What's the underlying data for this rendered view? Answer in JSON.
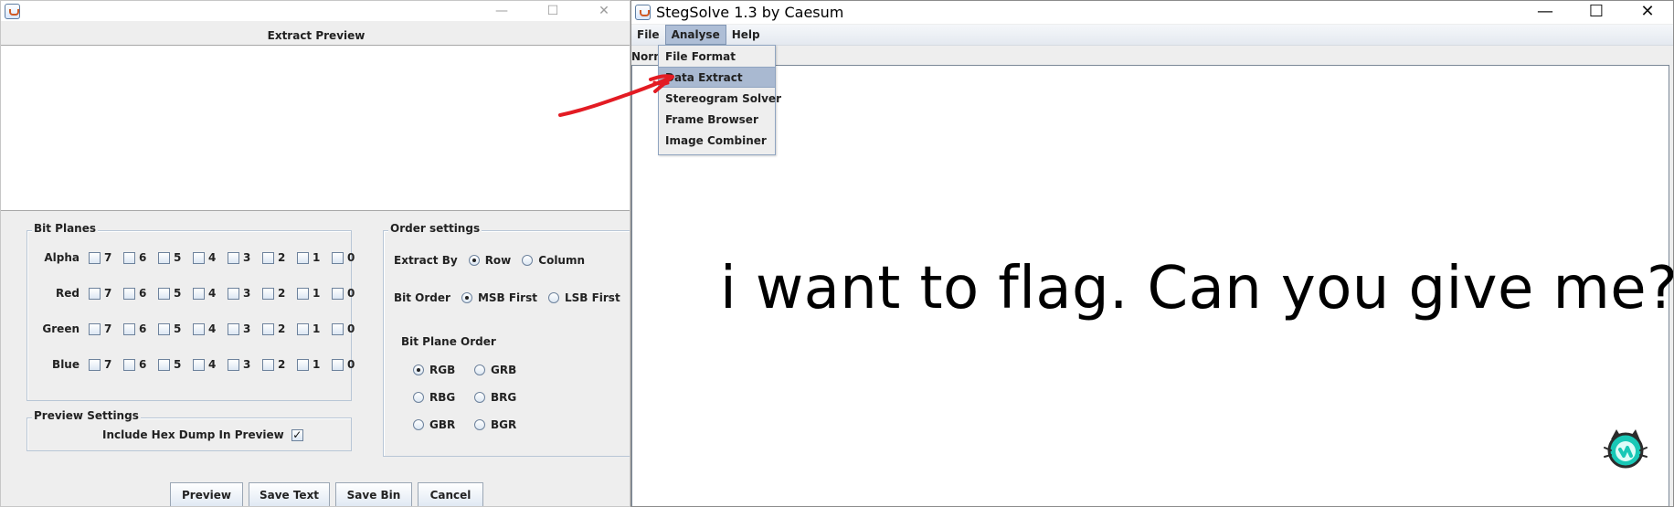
{
  "left_window": {
    "controls": {
      "minimize": "—",
      "maximize": "☐",
      "close": "✕"
    },
    "heading": "Extract Preview",
    "bit_planes": {
      "title": "Bit Planes",
      "rows": [
        {
          "label": "Alpha",
          "bits": [
            "7",
            "6",
            "5",
            "4",
            "3",
            "2",
            "1",
            "0"
          ]
        },
        {
          "label": "Red",
          "bits": [
            "7",
            "6",
            "5",
            "4",
            "3",
            "2",
            "1",
            "0"
          ]
        },
        {
          "label": "Green",
          "bits": [
            "7",
            "6",
            "5",
            "4",
            "3",
            "2",
            "1",
            "0"
          ]
        },
        {
          "label": "Blue",
          "bits": [
            "7",
            "6",
            "5",
            "4",
            "3",
            "2",
            "1",
            "0"
          ]
        }
      ]
    },
    "order_settings": {
      "title": "Order settings",
      "extract_by_label": "Extract By",
      "extract_options": [
        "Row",
        "Column"
      ],
      "selected_extract": "Row",
      "bit_order_label": "Bit Order",
      "bit_order_options": [
        "MSB First",
        "LSB First"
      ],
      "selected_bit_order": "MSB First",
      "bit_plane_order_label": "Bit Plane Order",
      "plane_options": [
        "RGB",
        "GRB",
        "RBG",
        "BRG",
        "GBR",
        "BGR"
      ],
      "selected_plane": "RGB"
    },
    "preview_settings": {
      "title": "Preview Settings",
      "include_hex_dump": "Include Hex Dump In Preview",
      "hex_checked_mark": "✓"
    },
    "buttons": {
      "preview": "Preview",
      "save_text": "Save Text",
      "save_bin": "Save Bin",
      "cancel": "Cancel"
    }
  },
  "right_window": {
    "title": "StegSolve 1.3 by Caesum",
    "controls": {
      "minimize": "—",
      "maximize": "☐",
      "close": "✕"
    },
    "menu": {
      "file": "File",
      "analyse": "Analyse",
      "help": "Help"
    },
    "status_fragment": "Norm",
    "analyse_menu_items": [
      "File Format",
      "Data Extract",
      "Stereogram Solver",
      "Frame Browser",
      "Image Combiner"
    ],
    "highlighted_menu_item": "Data Extract",
    "image_text": "i want to flag. Can you give me?"
  },
  "colors": {
    "annotation_red": "#e31b23",
    "selected_menu": "#aebed6",
    "window_background": "#eeeeee",
    "mascot_teal": "#19c8b6"
  }
}
